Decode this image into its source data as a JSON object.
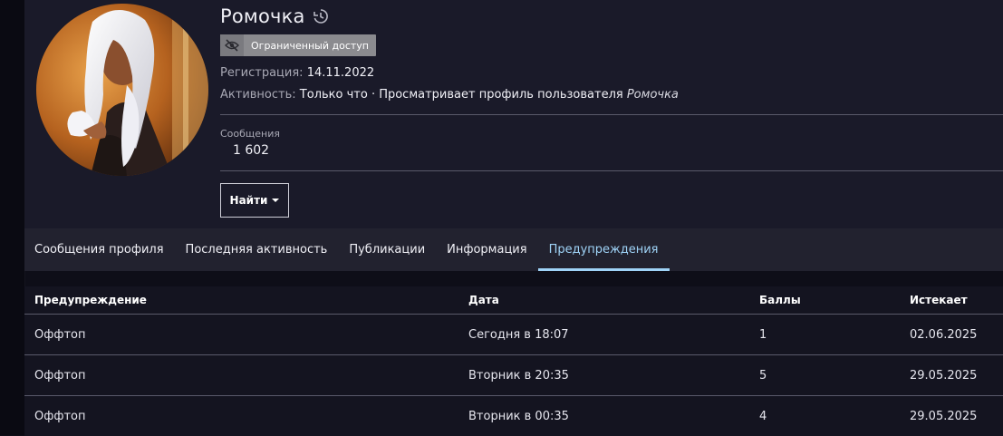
{
  "profile": {
    "username": "Ромочка",
    "badge": "Ограниченный доступ",
    "registration_label": "Регистрация:",
    "registration_date": "14.11.2022",
    "activity_label": "Активность:",
    "activity_text": "Только что · Просматривает профиль пользователя",
    "activity_target": "Ромочка",
    "stats": {
      "messages_label": "Сообщения",
      "messages_value": "1 602"
    },
    "find_button": "Найти"
  },
  "tabs": [
    {
      "label": "Сообщения профиля",
      "active": false
    },
    {
      "label": "Последняя активность",
      "active": false
    },
    {
      "label": "Публикации",
      "active": false
    },
    {
      "label": "Информация",
      "active": false
    },
    {
      "label": "Предупреждения",
      "active": true
    }
  ],
  "warnings_table": {
    "headers": [
      "Предупреждение",
      "Дата",
      "Баллы",
      "Истекает"
    ],
    "rows": [
      [
        "Оффтоп",
        "Сегодня в 18:07",
        "1",
        "02.06.2025"
      ],
      [
        "Оффтоп",
        "Вторник в 20:35",
        "5",
        "29.05.2025"
      ],
      [
        "Оффтоп",
        "Вторник в 00:35",
        "4",
        "29.05.2025"
      ]
    ]
  },
  "colors": {
    "accent": "#9fd3f7",
    "header_bg": "#1a1a29",
    "tabs_bg": "#22222f",
    "badge_bg": "#8b8b8f"
  },
  "icons": {
    "history": "history-icon",
    "restricted": "eye-slash-icon",
    "find_caret": "caret-down-icon"
  }
}
